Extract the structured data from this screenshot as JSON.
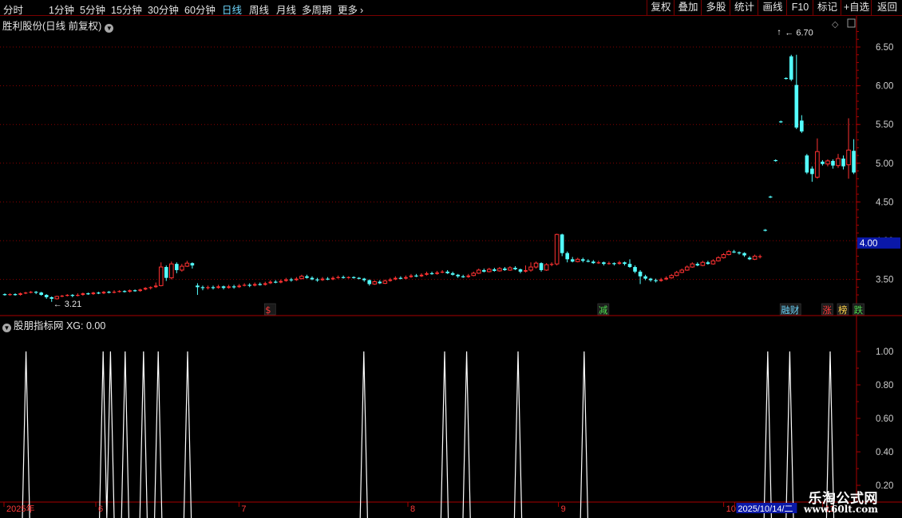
{
  "toolbar": {
    "left": [
      {
        "label": "分时",
        "active": false
      },
      {
        "label": "1分钟",
        "active": false
      },
      {
        "label": "5分钟",
        "active": false
      },
      {
        "label": "15分钟",
        "active": false
      },
      {
        "label": "30分钟",
        "active": false
      },
      {
        "label": "60分钟",
        "active": false
      },
      {
        "label": "日线",
        "active": true
      },
      {
        "label": "周线",
        "active": false
      },
      {
        "label": "月线",
        "active": false
      },
      {
        "label": "多周期",
        "active": false
      },
      {
        "label": "更多",
        "active": false
      }
    ],
    "more_arrow": "›",
    "right": [
      "复权",
      "叠加",
      "多股",
      "统计",
      "画线",
      "F10",
      "标记",
      "+自选",
      "返回"
    ]
  },
  "main_title": "胜利股份(日线 前复权)",
  "sub_title": "股朋指标网  XG: 0.00",
  "watermark": {
    "line1": "乐淘公式网",
    "line2": "www.60lt.com"
  },
  "colors": {
    "up": "#ff3232",
    "down": "#54ffff",
    "axis": "#a80000",
    "grid": "#8a0000",
    "signal": "#ffffff"
  },
  "chart_data": [
    {
      "type": "candlestick",
      "y_ticks": [
        3.5,
        4.0,
        4.5,
        5.0,
        5.5,
        6.0,
        6.5
      ],
      "ylim": [
        3.2,
        6.82
      ],
      "grid": true,
      "current_price_label": "4.00",
      "high_annotation": "6.70",
      "low_annotation": "3.21",
      "event_markers": [
        {
          "text": "$",
          "color": "#ff3a3a",
          "index": 50
        },
        {
          "text": "减",
          "color": "#4fdc4f",
          "index": 114
        },
        {
          "text": "融财",
          "color": "#6fd8ff",
          "index": 149
        },
        {
          "text": "涨",
          "color": "#ff3a3a",
          "index": 157
        },
        {
          "text": "榜",
          "color": "#ffd24a",
          "index": 160
        },
        {
          "text": "跌",
          "color": "#4fdc4f",
          "index": 163
        }
      ],
      "candles": [
        [
          3.31,
          3.3,
          3.32,
          3.29
        ],
        [
          3.3,
          3.31,
          3.32,
          3.29
        ],
        [
          3.31,
          3.3,
          3.32,
          3.29
        ],
        [
          3.3,
          3.32,
          3.33,
          3.29
        ],
        [
          3.32,
          3.33,
          3.34,
          3.31
        ],
        [
          3.33,
          3.34,
          3.35,
          3.32
        ],
        [
          3.34,
          3.33,
          3.35,
          3.31
        ],
        [
          3.33,
          3.3,
          3.34,
          3.29
        ],
        [
          3.3,
          3.27,
          3.31,
          3.25
        ],
        [
          3.27,
          3.25,
          3.28,
          3.21
        ],
        [
          3.25,
          3.28,
          3.29,
          3.24
        ],
        [
          3.28,
          3.29,
          3.3,
          3.27
        ],
        [
          3.29,
          3.3,
          3.31,
          3.28
        ],
        [
          3.3,
          3.29,
          3.31,
          3.27
        ],
        [
          3.29,
          3.3,
          3.32,
          3.28
        ],
        [
          3.3,
          3.32,
          3.33,
          3.29
        ],
        [
          3.32,
          3.31,
          3.33,
          3.3
        ],
        [
          3.31,
          3.33,
          3.34,
          3.3
        ],
        [
          3.33,
          3.32,
          3.34,
          3.31
        ],
        [
          3.32,
          3.34,
          3.35,
          3.31
        ],
        [
          3.34,
          3.33,
          3.35,
          3.32
        ],
        [
          3.33,
          3.34,
          3.36,
          3.32
        ],
        [
          3.34,
          3.35,
          3.36,
          3.33
        ],
        [
          3.35,
          3.34,
          3.36,
          3.33
        ],
        [
          3.34,
          3.36,
          3.37,
          3.33
        ],
        [
          3.36,
          3.35,
          3.37,
          3.34
        ],
        [
          3.35,
          3.37,
          3.38,
          3.34
        ],
        [
          3.37,
          3.39,
          3.4,
          3.36
        ],
        [
          3.39,
          3.4,
          3.41,
          3.37
        ],
        [
          3.4,
          3.42,
          3.46,
          3.39
        ],
        [
          3.42,
          3.66,
          3.72,
          3.41
        ],
        [
          3.66,
          3.52,
          3.68,
          3.48
        ],
        [
          3.52,
          3.7,
          3.73,
          3.5
        ],
        [
          3.7,
          3.62,
          3.72,
          3.58
        ],
        [
          3.62,
          3.67,
          3.7,
          3.6
        ],
        [
          3.67,
          3.71,
          3.74,
          3.66
        ],
        [
          3.71,
          3.68,
          3.72,
          3.64
        ],
        [
          3.42,
          3.4,
          3.45,
          3.3
        ],
        [
          3.4,
          3.39,
          3.42,
          3.36
        ],
        [
          3.39,
          3.4,
          3.42,
          3.37
        ],
        [
          3.4,
          3.39,
          3.42,
          3.37
        ],
        [
          3.39,
          3.41,
          3.43,
          3.38
        ],
        [
          3.41,
          3.39,
          3.42,
          3.37
        ],
        [
          3.39,
          3.41,
          3.43,
          3.38
        ],
        [
          3.41,
          3.4,
          3.43,
          3.38
        ],
        [
          3.4,
          3.42,
          3.44,
          3.39
        ],
        [
          3.42,
          3.43,
          3.45,
          3.41
        ],
        [
          3.43,
          3.42,
          3.45,
          3.4
        ],
        [
          3.42,
          3.44,
          3.46,
          3.41
        ],
        [
          3.44,
          3.43,
          3.46,
          3.42
        ],
        [
          3.43,
          3.45,
          3.47,
          3.42
        ],
        [
          3.45,
          3.47,
          3.49,
          3.44
        ],
        [
          3.47,
          3.46,
          3.49,
          3.45
        ],
        [
          3.46,
          3.48,
          3.5,
          3.45
        ],
        [
          3.48,
          3.5,
          3.52,
          3.47
        ],
        [
          3.5,
          3.49,
          3.52,
          3.47
        ],
        [
          3.49,
          3.51,
          3.53,
          3.48
        ],
        [
          3.51,
          3.54,
          3.56,
          3.5
        ],
        [
          3.54,
          3.52,
          3.56,
          3.51
        ],
        [
          3.52,
          3.5,
          3.54,
          3.49
        ],
        [
          3.5,
          3.49,
          3.52,
          3.47
        ],
        [
          3.49,
          3.51,
          3.53,
          3.48
        ],
        [
          3.51,
          3.5,
          3.53,
          3.49
        ],
        [
          3.5,
          3.52,
          3.54,
          3.49
        ],
        [
          3.52,
          3.53,
          3.55,
          3.51
        ],
        [
          3.53,
          3.52,
          3.55,
          3.51
        ],
        [
          3.52,
          3.53,
          3.54,
          3.51
        ],
        [
          3.53,
          3.52,
          3.54,
          3.51
        ],
        [
          3.52,
          3.51,
          3.53,
          3.5
        ],
        [
          3.51,
          3.49,
          3.52,
          3.47
        ],
        [
          3.49,
          3.44,
          3.5,
          3.42
        ],
        [
          3.44,
          3.47,
          3.49,
          3.43
        ],
        [
          3.47,
          3.45,
          3.49,
          3.44
        ],
        [
          3.45,
          3.48,
          3.5,
          3.44
        ],
        [
          3.48,
          3.5,
          3.52,
          3.47
        ],
        [
          3.5,
          3.52,
          3.54,
          3.49
        ],
        [
          3.52,
          3.51,
          3.54,
          3.5
        ],
        [
          3.51,
          3.53,
          3.55,
          3.5
        ],
        [
          3.53,
          3.55,
          3.57,
          3.52
        ],
        [
          3.55,
          3.54,
          3.57,
          3.53
        ],
        [
          3.54,
          3.56,
          3.58,
          3.53
        ],
        [
          3.56,
          3.58,
          3.6,
          3.55
        ],
        [
          3.58,
          3.57,
          3.6,
          3.56
        ],
        [
          3.57,
          3.59,
          3.61,
          3.56
        ],
        [
          3.59,
          3.6,
          3.62,
          3.58
        ],
        [
          3.6,
          3.58,
          3.62,
          3.57
        ],
        [
          3.58,
          3.56,
          3.6,
          3.55
        ],
        [
          3.56,
          3.54,
          3.57,
          3.52
        ],
        [
          3.54,
          3.53,
          3.56,
          3.52
        ],
        [
          3.53,
          3.55,
          3.57,
          3.52
        ],
        [
          3.55,
          3.58,
          3.6,
          3.54
        ],
        [
          3.58,
          3.62,
          3.64,
          3.57
        ],
        [
          3.62,
          3.6,
          3.64,
          3.59
        ],
        [
          3.6,
          3.63,
          3.65,
          3.59
        ],
        [
          3.63,
          3.61,
          3.65,
          3.6
        ],
        [
          3.61,
          3.64,
          3.66,
          3.6
        ],
        [
          3.64,
          3.62,
          3.66,
          3.61
        ],
        [
          3.62,
          3.65,
          3.67,
          3.61
        ],
        [
          3.65,
          3.63,
          3.67,
          3.62
        ],
        [
          3.63,
          3.6,
          3.64,
          3.58
        ],
        [
          3.6,
          3.62,
          3.68,
          3.59
        ],
        [
          3.62,
          3.66,
          3.72,
          3.6
        ],
        [
          3.66,
          3.71,
          3.73,
          3.64
        ],
        [
          3.71,
          3.62,
          3.72,
          3.6
        ],
        [
          3.62,
          3.69,
          3.71,
          3.61
        ],
        [
          3.69,
          3.7,
          3.72,
          3.67
        ],
        [
          3.7,
          4.08,
          4.09,
          3.68
        ],
        [
          4.08,
          3.84,
          4.09,
          3.8
        ],
        [
          3.84,
          3.76,
          3.86,
          3.72
        ],
        [
          3.76,
          3.73,
          3.79,
          3.72
        ],
        [
          3.73,
          3.76,
          3.78,
          3.72
        ],
        [
          3.76,
          3.74,
          3.78,
          3.72
        ],
        [
          3.74,
          3.73,
          3.76,
          3.72
        ],
        [
          3.73,
          3.71,
          3.75,
          3.7
        ],
        [
          3.71,
          3.72,
          3.74,
          3.7
        ],
        [
          3.72,
          3.7,
          3.73,
          3.68
        ],
        [
          3.7,
          3.71,
          3.73,
          3.69
        ],
        [
          3.71,
          3.7,
          3.72,
          3.68
        ],
        [
          3.7,
          3.72,
          3.74,
          3.69
        ],
        [
          3.72,
          3.7,
          3.73,
          3.68
        ],
        [
          3.7,
          3.66,
          3.76,
          3.65
        ],
        [
          3.66,
          3.6,
          3.68,
          3.58
        ],
        [
          3.6,
          3.54,
          3.62,
          3.44
        ],
        [
          3.54,
          3.51,
          3.56,
          3.49
        ],
        [
          3.51,
          3.49,
          3.52,
          3.47
        ],
        [
          3.49,
          3.48,
          3.51,
          3.46
        ],
        [
          3.48,
          3.5,
          3.52,
          3.47
        ],
        [
          3.5,
          3.52,
          3.54,
          3.49
        ],
        [
          3.52,
          3.55,
          3.57,
          3.51
        ],
        [
          3.55,
          3.59,
          3.61,
          3.54
        ],
        [
          3.59,
          3.62,
          3.64,
          3.58
        ],
        [
          3.62,
          3.66,
          3.68,
          3.61
        ],
        [
          3.66,
          3.7,
          3.72,
          3.65
        ],
        [
          3.7,
          3.68,
          3.72,
          3.67
        ],
        [
          3.68,
          3.72,
          3.74,
          3.67
        ],
        [
          3.72,
          3.7,
          3.74,
          3.69
        ],
        [
          3.7,
          3.74,
          3.76,
          3.69
        ],
        [
          3.74,
          3.78,
          3.8,
          3.73
        ],
        [
          3.78,
          3.82,
          3.84,
          3.77
        ],
        [
          3.82,
          3.86,
          3.88,
          3.81
        ],
        [
          3.86,
          3.85,
          3.88,
          3.84
        ],
        [
          3.85,
          3.84,
          3.86,
          3.82
        ],
        [
          3.84,
          3.81,
          3.85,
          3.79
        ],
        [
          3.78,
          3.76,
          3.8,
          3.75
        ],
        [
          3.76,
          3.8,
          3.82,
          3.75
        ],
        [
          3.79,
          3.8,
          3.82,
          3.77
        ],
        [
          4.14,
          4.13,
          4.15,
          4.12
        ],
        [
          4.57,
          4.56,
          4.58,
          4.55
        ],
        [
          5.04,
          5.03,
          5.05,
          5.02
        ],
        [
          5.54,
          5.53,
          5.55,
          5.52
        ],
        [
          6.1,
          6.09,
          6.11,
          6.08
        ],
        [
          6.38,
          6.08,
          6.4,
          6.06
        ],
        [
          6.01,
          5.46,
          6.4,
          5.44
        ],
        [
          5.55,
          5.41,
          5.62,
          5.39
        ],
        [
          5.1,
          4.88,
          5.12,
          4.86
        ],
        [
          4.93,
          4.86,
          4.96,
          4.76
        ],
        [
          4.82,
          5.15,
          5.32,
          4.8
        ],
        [
          5.02,
          4.99,
          5.04,
          4.97
        ],
        [
          4.99,
          5.03,
          5.05,
          4.96
        ],
        [
          5.03,
          4.97,
          5.05,
          4.93
        ],
        [
          4.97,
          5.06,
          5.12,
          4.94
        ],
        [
          5.06,
          4.96,
          5.1,
          4.92
        ],
        [
          4.98,
          5.17,
          5.58,
          4.8
        ],
        [
          5.16,
          4.88,
          5.31,
          4.86
        ]
      ]
    },
    {
      "type": "line",
      "series": [
        {
          "name": "XG",
          "peaks": [
            6,
            27,
            29,
            33,
            38,
            42,
            50,
            98,
            120,
            126,
            140,
            158,
            208,
            214,
            225
          ]
        }
      ],
      "period_count": 231,
      "y_ticks": [
        0.2,
        0.4,
        0.6,
        0.8,
        1.0
      ],
      "ylim": [
        0,
        1.05
      ],
      "x_labels": [
        {
          "text": "2025年",
          "index": 0
        },
        {
          "text": "6",
          "index": 25
        },
        {
          "text": "7",
          "index": 64
        },
        {
          "text": "8",
          "index": 110
        },
        {
          "text": "9",
          "index": 151
        },
        {
          "text": "10",
          "index": 196
        },
        {
          "text": "2025/10/14/二",
          "index": 199,
          "highlight": true
        },
        {
          "text": "11",
          "index": 223
        }
      ]
    }
  ]
}
